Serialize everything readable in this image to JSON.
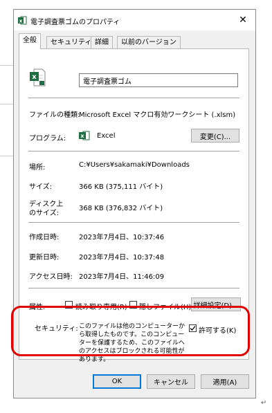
{
  "window": {
    "title": "電子調査票ゴムのプロパティ",
    "close_label": "✕"
  },
  "tabs": [
    {
      "label": "全般",
      "active": true
    },
    {
      "label": "セキュリティ",
      "active": false
    },
    {
      "label": "詳細",
      "active": false
    },
    {
      "label": "以前のバージョン",
      "active": false
    }
  ],
  "general": {
    "file_name": "電子調査票ゴム",
    "file_type_label": "ファイルの種類:",
    "file_type_value": "Microsoft Excel マクロ有効ワークシート (.xlsm)",
    "program_label": "プログラム:",
    "program_value": "Excel",
    "change_button": "変更(C)...",
    "location_label": "場所:",
    "location_value": "C:¥Users¥sakamaki¥Downloads",
    "size_label": "サイズ:",
    "size_value": "366 KB (375,111 バイト)",
    "disk_size_label_1": "ディスク上",
    "disk_size_label_2": "のサイズ:",
    "disk_size_value": "368 KB (376,832 バイト)",
    "created_label": "作成日時:",
    "created_value": "2023年7月4日、10:37:46",
    "modified_label": "更新日時:",
    "modified_value": "2023年7月4日、10:37:48",
    "accessed_label": "アクセス日時:",
    "accessed_value": "2023年7月4日、11:46:09",
    "attributes_label": "属性:",
    "readonly_label": "読み取り専用(R)",
    "readonly_checked": false,
    "hidden_label": "隠しファイル(H)",
    "hidden_checked": false,
    "advanced_button": "詳細設定(D)...",
    "security_label": "セキュリティ:",
    "security_text": "このファイルは他のコンピューターから取得したものです。このコンピューターを保護するため、このファイルへのアクセスはブロックされる可能性があります。",
    "unblock_label": "許可する(K)",
    "unblock_checked": true
  },
  "footer": {
    "ok": "OK",
    "cancel": "キャンセル",
    "apply": "適用(A)"
  },
  "colors": {
    "highlight": "#e00000",
    "excel_green": "#1d6f42",
    "default_button_border": "#0078d7"
  },
  "icons": {
    "title": "excel-file-icon",
    "file": "excel-file-icon",
    "program": "excel-icon",
    "close": "close-icon",
    "check": "check-icon"
  }
}
